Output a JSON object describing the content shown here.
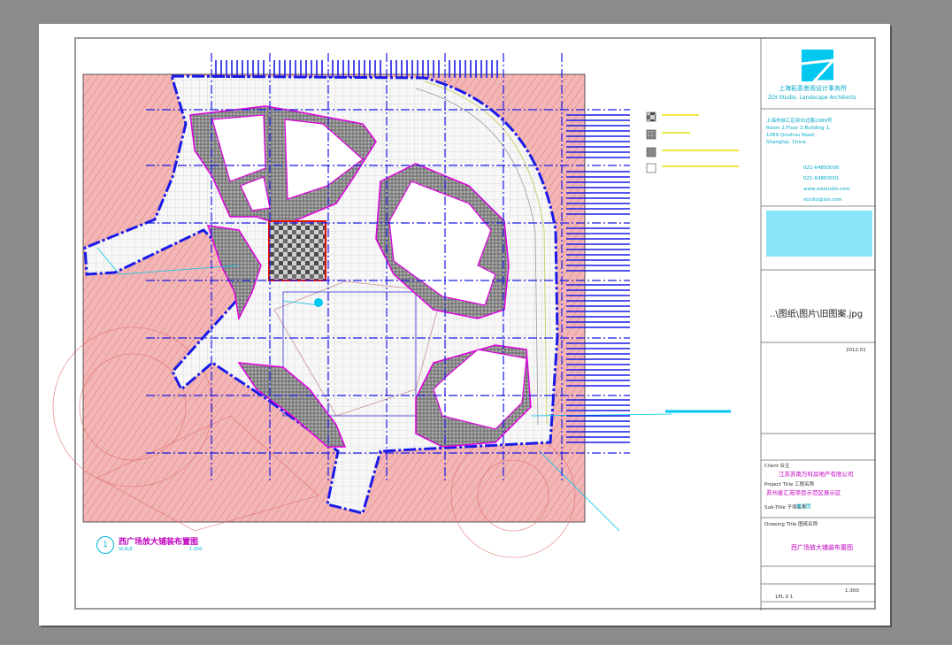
{
  "drawing": {
    "title": "西广场放大铺装布置图",
    "number": "1",
    "scale_label": "SCALE",
    "scale_value": "1:300",
    "legend_items": [
      "",
      "",
      "",
      ""
    ],
    "image_path": "..\\图纸\\图片\\旧图案.jpg"
  },
  "title_block": {
    "company_cn": "上海拓意景观设计事务所",
    "company_en": "ZOI Studio, Landscape Architects",
    "address_lines": [
      "上海市徐汇区钦州北路1089号",
      "Room 2,Floor 2,Building 1,",
      "1089 Qinzhou Road,",
      "Shanghai, China"
    ],
    "tel": "021-64850000",
    "fax": "021-64850001",
    "web": "www.zoistudio.com",
    "email": "studio@zoi.com",
    "client_label": "Client 业主",
    "client": "江苏苏南万科房地产有限公司",
    "project_label": "Project Title 工程名称",
    "project": "苏州星汇苑项目示范区展示区",
    "sub_label": "Sub-Title 子项名称",
    "drawing_title_label": "Drawing Title 图纸名称",
    "drawing_title": "西广场放大铺装布置图",
    "date": "2012.01",
    "drawing_no": "1PL 0 1",
    "scale": "1:300",
    "stage": "施工图",
    "colors": {
      "magenta": "#e000e0",
      "cyan": "#00c8f0",
      "blue": "#1a1ae8",
      "red": "#e83030"
    }
  }
}
